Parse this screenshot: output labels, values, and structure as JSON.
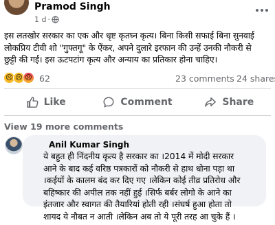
{
  "post": {
    "author_name": "Pramod Singh",
    "time": "1 d",
    "separator": "·",
    "text_lines": [
      "इस लतखोर सरकार का एक और धृष्ट कृतघ्न कृत्य। बिना किसी सफाई बिना सुनवाई",
      "लोकप्रिय टीवी शो \"गुफ्तगू\" के ऐंकर, अपने दुलारे इरफान की उन्हें उनकी नौकरी से",
      "छुट्टी की गई। इस ऊटपटांग कृत्य और अन्याय का प्रतिकार होना चाहिए।"
    ]
  },
  "reactions": {
    "count": "62",
    "icons": [
      "sad-emoji",
      "angry-emoji"
    ],
    "comments": "23 comments",
    "shares": "24 shares"
  },
  "actions": {
    "like_label": "Like",
    "comment_label": "Comment",
    "share_label": "Share"
  },
  "view_more": "View 19 more comments",
  "comment": {
    "author_name": "Anil Kumar Singh",
    "text_lines": [
      "ये बहुत ही निंदनीय कृत्य है सरकार का ।2014 में मोदी सरकार",
      "आने के बाद कई वरिष्ठ पत्रकारों को नौकरी से हाथ धोना पड़ा था",
      "।कईयों के कालम बंद कर दिए गए ।लेकिन कोई तीव्र प्रतिरोध और",
      "बहिष्कार की अपील तक नहीं हुई ।सिर्फ बर्बर लोगो के आने का",
      "इंतजार और स्वागत की तैयारियां होती रही ।संघर्ष हुआ होता तो",
      "शायद ये नौबत न आती ।लेकिन अब तो ये पूरी तरह आ चुके हैं ।"
    ]
  },
  "colors": {
    "secondary_text": "#65676b",
    "bubble_bg": "#f0f2f5",
    "divider": "#ced0d4"
  }
}
